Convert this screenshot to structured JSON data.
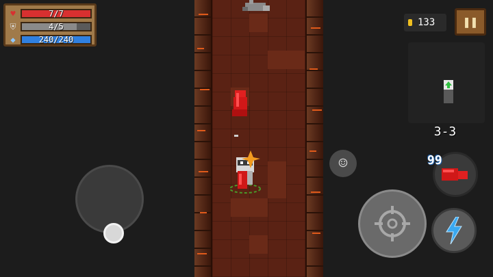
{
  "status": {
    "health": {
      "text": "7/7",
      "fraction": 1.0,
      "color": "#d83030"
    },
    "armor": {
      "text": "4/5",
      "fraction": 0.8,
      "color": "#8a8a8a"
    },
    "energy": {
      "text": "240/240",
      "fraction": 1.0,
      "color": "#3080e0"
    }
  },
  "coins": {
    "count": "133"
  },
  "level": "3-3",
  "weapon": {
    "energy_cost": "99",
    "name": "red-gauntlet-icon"
  },
  "icons": {
    "pause": "pause-icon",
    "emote": "smiley-icon",
    "attack": "crosshair-icon",
    "skill": "lightning-icon"
  }
}
